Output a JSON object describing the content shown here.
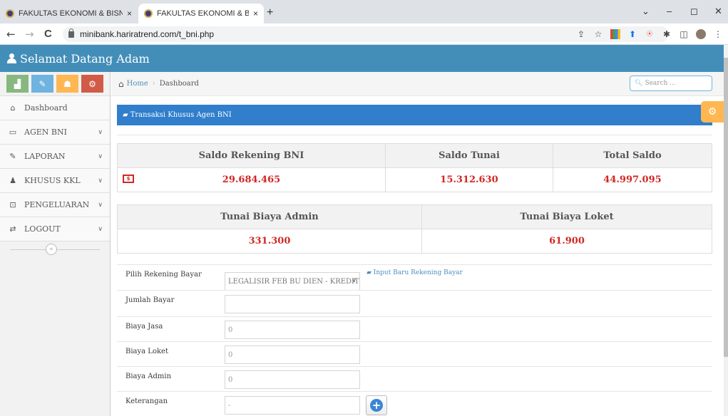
{
  "browser": {
    "tabs": [
      {
        "title": "FAKULTAS EKONOMI & BISNIS",
        "active": false
      },
      {
        "title": "FAKULTAS EKONOMI & BISNIS",
        "active": true
      }
    ],
    "close_symbol": "×",
    "new_tab_symbol": "+",
    "url": "minibank.hariratrend.com/t_bni.php",
    "nav": {
      "back": "←",
      "forward": "→",
      "reload": "C"
    },
    "window": {
      "minimize": "–",
      "maximize": "◻",
      "close": "✕",
      "tabsearch": "⌄"
    }
  },
  "header": {
    "title": "Selamat Datang Adam"
  },
  "sidebar": {
    "shortcut_colors": [
      "#87b87f",
      "#6fb3e0",
      "#ffb752",
      "#d15b47"
    ],
    "items": [
      {
        "label": "Dashboard",
        "icon": "home-icon",
        "has_children": false
      },
      {
        "label": "AGEN BNI",
        "icon": "desktop-icon",
        "has_children": true
      },
      {
        "label": "LAPORAN",
        "icon": "edit-icon",
        "has_children": true
      },
      {
        "label": "KHUSUS KKL",
        "icon": "user-icon",
        "has_children": true
      },
      {
        "label": "PENGELUARAN",
        "icon": "money-icon",
        "has_children": true
      },
      {
        "label": "LOGOUT",
        "icon": "exchange-icon",
        "has_children": true
      }
    ]
  },
  "breadcrumb": {
    "home": "Home",
    "current": "Dashboard"
  },
  "search": {
    "placeholder": "Search ..."
  },
  "panel": {
    "title": "Transaksi Khusus Agen BNI"
  },
  "summary1": {
    "headers": [
      "Saldo Rekening BNI",
      "Saldo Tunai",
      "Total Saldo"
    ],
    "values": [
      "29.684.465",
      "15.312.630",
      "44.997.095"
    ]
  },
  "summary2": {
    "headers": [
      "Tunai Biaya Admin",
      "Tunai Biaya Loket"
    ],
    "values": [
      "331.300",
      "61.900"
    ]
  },
  "form": {
    "rekening_label": "Pilih Rekening Bayar",
    "rekening_value": "LEGALISIR FEB BU DIEN - KREDIT",
    "input_baru_link": "Input Baru Rekening Bayar",
    "jumlah_label": "Jumlah Bayar",
    "jumlah_value": "",
    "jasa_label": "Biaya Jasa",
    "jasa_value": "0",
    "loket_label": "Biaya Loket",
    "loket_value": "0",
    "admin_label": "Biaya Admin",
    "admin_value": "0",
    "keterangan_label": "Keterangan",
    "keterangan_value": "-"
  },
  "colors": {
    "header": "#438eb9",
    "panel": "#307ecc",
    "value_red": "#d12723"
  }
}
